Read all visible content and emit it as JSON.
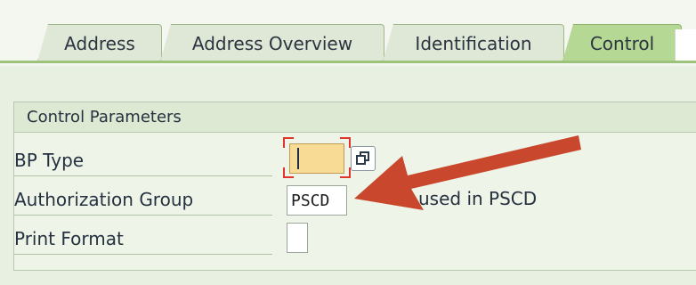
{
  "tabs": [
    {
      "label": "Address",
      "active": false
    },
    {
      "label": "Address Overview",
      "active": false
    },
    {
      "label": "Identification",
      "active": false
    },
    {
      "label": "Control",
      "active": true
    }
  ],
  "group": {
    "title": "Control Parameters"
  },
  "fields": {
    "bp_type": {
      "label": "BP Type",
      "value": ""
    },
    "authorization_group": {
      "label": "Authorization Group",
      "value": "PSCD",
      "description": "used in PSCD"
    },
    "print_format": {
      "label": "Print Format",
      "value": ""
    }
  },
  "annotation": {
    "arrow_color": "#c9472c"
  }
}
